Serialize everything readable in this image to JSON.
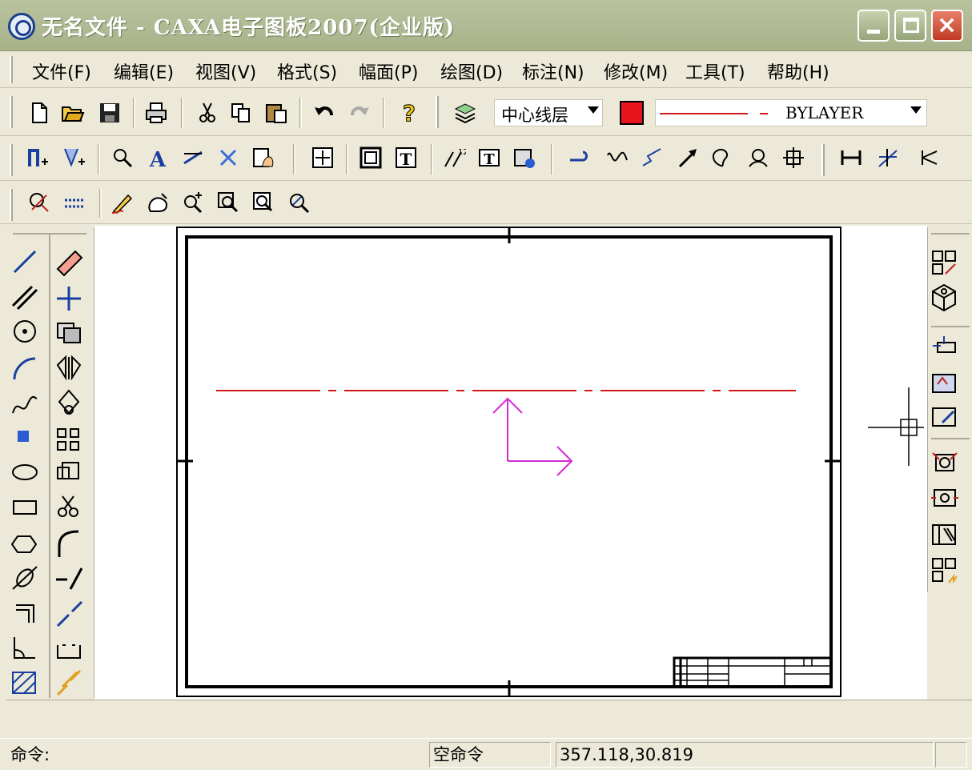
{
  "window": {
    "title": "无名文件 - CAXA电子图板2007(企业版)",
    "controls": {
      "minimize": "minimize",
      "maximize": "maximize",
      "close": "×"
    }
  },
  "menu": [
    "文件(F)",
    "编辑(E)",
    "视图(V)",
    "格式(S)",
    "幅面(P)",
    "绘图(D)",
    "标注(N)",
    "修改(M)",
    "工具(T)",
    "帮助(H)"
  ],
  "toolbar": {
    "layer_value": "中心线层",
    "linetype_value": "BYLAYER",
    "color": "#e8151f"
  },
  "drawing": {
    "centerline_color": "#d31616",
    "ucs_color": "#d42ad4",
    "frame_color": "#000000"
  },
  "status": {
    "command_label": "命令:",
    "current_command": "空命令",
    "coordinates": "357.118,30.819"
  }
}
